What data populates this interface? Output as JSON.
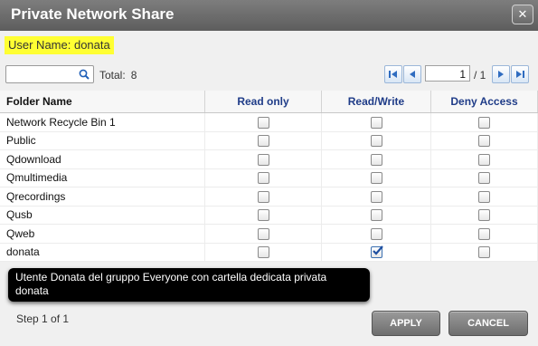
{
  "window": {
    "title": "Private Network Share",
    "close_glyph": "✕"
  },
  "user": {
    "label": "User Name: donata"
  },
  "search": {
    "placeholder": "",
    "value": ""
  },
  "total": {
    "label": "Total:",
    "count": "8"
  },
  "pager": {
    "current_page": "1",
    "total_pages": "/ 1"
  },
  "table": {
    "headers": {
      "folder": "Folder Name",
      "read_only": "Read only",
      "read_write": "Read/Write",
      "deny": "Deny Access"
    },
    "rows": [
      {
        "name": "Network Recycle Bin 1",
        "read_only": false,
        "read_write": false,
        "deny": false
      },
      {
        "name": "Public",
        "read_only": false,
        "read_write": false,
        "deny": false
      },
      {
        "name": "Qdownload",
        "read_only": false,
        "read_write": false,
        "deny": false
      },
      {
        "name": "Qmultimedia",
        "read_only": false,
        "read_write": false,
        "deny": false
      },
      {
        "name": "Qrecordings",
        "read_only": false,
        "read_write": false,
        "deny": false
      },
      {
        "name": "Qusb",
        "read_only": false,
        "read_write": false,
        "deny": false
      },
      {
        "name": "Qweb",
        "read_only": false,
        "read_write": false,
        "deny": false
      },
      {
        "name": "donata",
        "read_only": false,
        "read_write": true,
        "deny": false
      }
    ]
  },
  "tooltip": {
    "text": "Utente Donata del gruppo Everyone con cartella dedicata privata donata"
  },
  "footer": {
    "step": "Step 1 of 1",
    "apply": "APPLY",
    "cancel": "CANCEL"
  },
  "colors": {
    "accent": "#1f3c88",
    "highlight": "#ffff33"
  }
}
